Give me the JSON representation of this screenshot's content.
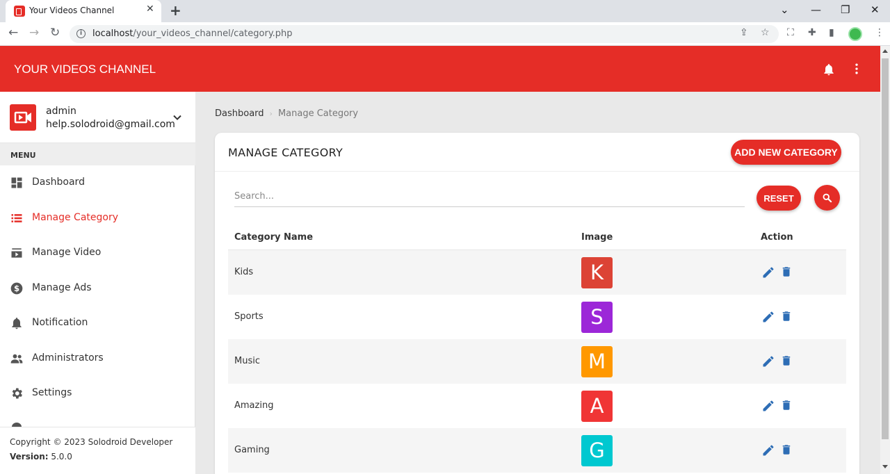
{
  "browser": {
    "tab_title": "Your Videos Channel",
    "url_host": "localhost",
    "url_path": "/your_videos_channel/category.php"
  },
  "app": {
    "title": "YOUR VIDEOS CHANNEL"
  },
  "user": {
    "name": "admin",
    "email": "help.solodroid@gmail.com"
  },
  "sidebar": {
    "menu_header": "MENU",
    "items": [
      {
        "label": "Dashboard",
        "icon": "dashboard-icon"
      },
      {
        "label": "Manage Category",
        "icon": "list-icon",
        "active": true
      },
      {
        "label": "Manage Video",
        "icon": "video-library-icon"
      },
      {
        "label": "Manage Ads",
        "icon": "dollar-icon"
      },
      {
        "label": "Notification",
        "icon": "bell-icon"
      },
      {
        "label": "Administrators",
        "icon": "people-icon"
      },
      {
        "label": "Settings",
        "icon": "gear-icon"
      }
    ],
    "footer": {
      "copyright": "Copyright © 2023 Solodroid Developer",
      "version_label": "Version:",
      "version_value": " 5.0.0"
    }
  },
  "breadcrumb": {
    "home": "Dashboard",
    "current": "Manage Category"
  },
  "card": {
    "title": "MANAGE CATEGORY",
    "add_button": "ADD NEW CATEGORY",
    "search_placeholder": "Search...",
    "reset_button": "RESET"
  },
  "table": {
    "headers": [
      "Category Name",
      "Image",
      "Action"
    ],
    "rows": [
      {
        "name": "Kids",
        "letter": "K",
        "color": "#dc4335"
      },
      {
        "name": "Sports",
        "letter": "S",
        "color": "#9c27d8"
      },
      {
        "name": "Music",
        "letter": "M",
        "color": "#ff9800"
      },
      {
        "name": "Amazing",
        "letter": "A",
        "color": "#f03535"
      },
      {
        "name": "Gaming",
        "letter": "G",
        "color": "#00c8d0"
      }
    ]
  },
  "colors": {
    "primary": "#e52d27",
    "action_icon": "#2d6db5"
  }
}
